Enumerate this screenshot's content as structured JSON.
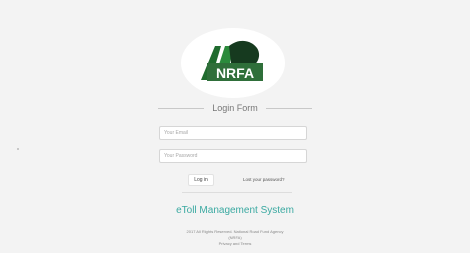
{
  "logo": {
    "text": "NRFA",
    "icon": "nrfa-logo"
  },
  "form": {
    "title": "Login Form",
    "email_placeholder": "Your Email",
    "password_placeholder": "Your Password",
    "login_label": "Log in",
    "lost_password_label": "Lost your password?"
  },
  "system_title": "eToll Management System",
  "footer": {
    "line1": "2017 All Rights Reserved. National Road Fund Agency",
    "line2": "(NRFA)",
    "line3": "Privacy and Terms"
  },
  "colors": {
    "accent": "#3aa9a1",
    "background": "#f3f3f3"
  }
}
